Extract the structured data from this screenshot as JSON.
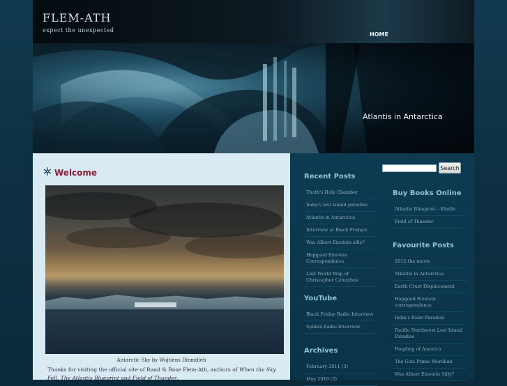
{
  "header": {
    "site_title": "FLEM-ATH",
    "tagline": "expect the unexpected",
    "nav": {
      "home": "HOME"
    }
  },
  "banner": {
    "caption": "Atlantis in Antarctica"
  },
  "post": {
    "title": "Welcome",
    "photo_caption": "Antarctic Sky by Wojtiens Dinmdieh",
    "intro_part1": "Thanks for visiting the official site of Rand & Rose Flem-Ath, authors of ",
    "book1": "When the Sky Fell",
    "sep1": ", ",
    "book2": "The Atlantis Blueprint",
    "sep2": " and ",
    "book3": "Field of Thunder",
    "end": "."
  },
  "search": {
    "placeholder": "",
    "button": "Search"
  },
  "recent_posts": {
    "title": "Recent Posts",
    "items": [
      "Thoth's Holy Chamber",
      "India's lost island paradise",
      "Atlantis in Antarctica",
      "Interview at Black Fridays",
      "Was Albert Einstein silly?",
      "Hapgood Einstein Correspondence",
      "Lost World Map of Christopher Columbus"
    ]
  },
  "youtube": {
    "title": "YouTube",
    "items": [
      "Black Friday Radio Interview",
      "Sphinx Radio Interview"
    ]
  },
  "archives": {
    "title": "Archives",
    "items": [
      {
        "label": "February 2011",
        "count": "(3)"
      },
      {
        "label": "May 2010",
        "count": "(2)"
      }
    ]
  },
  "buy_books": {
    "title": "Buy Books Online",
    "items": [
      "Atlantis Blueprint – Kindle",
      "Field of Thunder"
    ]
  },
  "favourite_posts": {
    "title": "Favourite Posts",
    "items": [
      "2012 the movie",
      "Atlantis in Antarctica",
      "Earth Crust Displacement",
      "Hapgood Einstein correspondence",
      "India's Polar Paradise",
      "Pacific Northwest Lost Island Paradise",
      "Peopling of America",
      "The Giza Prime Meridian",
      "Was Albert Einstein Silly?"
    ]
  },
  "colors": {
    "title_accent": "#8a1e3a",
    "sidebar_heading": "#8fc4d8",
    "content_bg": "#d9eaf2",
    "sidebar_bg": "#0d3b52"
  }
}
